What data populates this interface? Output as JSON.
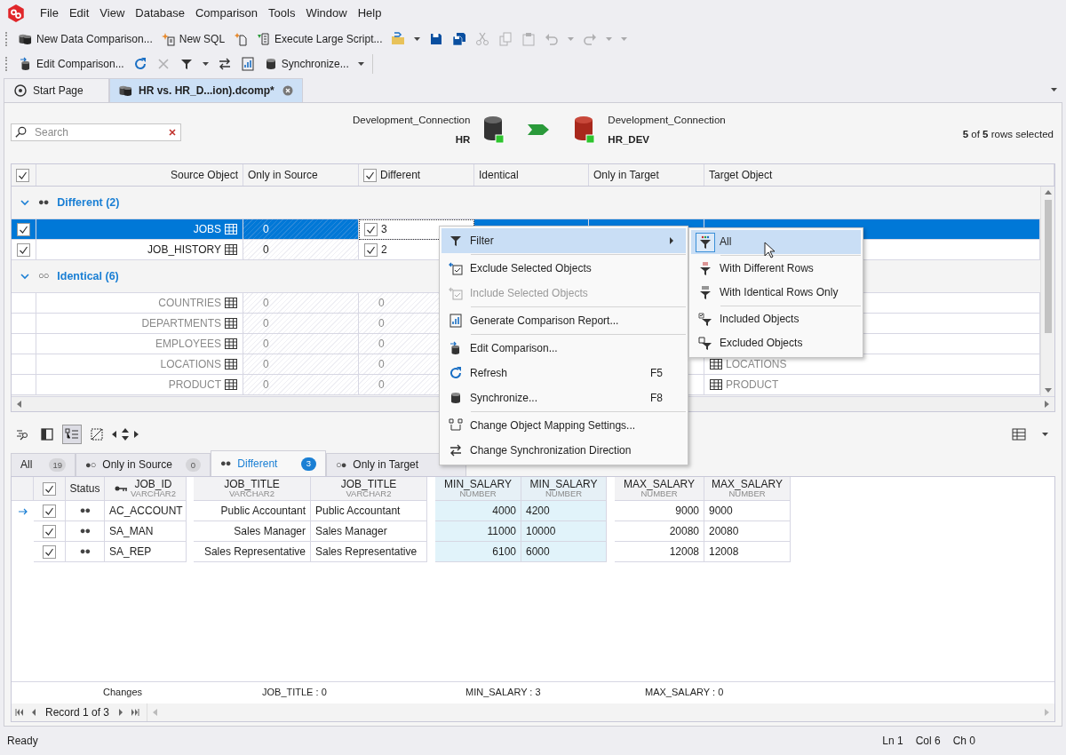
{
  "app_menu": [
    "File",
    "Edit",
    "View",
    "Database",
    "Comparison",
    "Tools",
    "Window",
    "Help"
  ],
  "toolbar_1": [
    {
      "label": "New Data Comparison...",
      "disabled": false,
      "dropdown": false
    },
    {
      "label": "New SQL",
      "disabled": false,
      "dropdown": false
    },
    {
      "disabled": false,
      "dropdown": false
    },
    {
      "label": "Execute Large Script...",
      "disabled": false,
      "dropdown": false
    },
    {
      "disabled": false,
      "dropdown": true
    },
    {
      "disabled": false,
      "dropdown": false
    },
    {
      "disabled": false,
      "dropdown": false
    },
    {
      "disabled": true,
      "dropdown": false
    },
    {
      "disabled": true,
      "dropdown": false
    },
    {
      "disabled": true,
      "dropdown": false
    },
    {
      "disabled": true,
      "dropdown": true
    },
    {
      "disabled": true,
      "dropdown": true
    }
  ],
  "toolbar_2": [
    {
      "label": "Edit Comparison...",
      "disabled": false,
      "dropdown": false
    },
    {
      "disabled": false,
      "dropdown": false
    },
    {
      "disabled": true,
      "dropdown": false
    },
    {
      "disabled": false,
      "dropdown": true
    },
    {
      "disabled": false,
      "dropdown": false
    },
    {
      "disabled": false,
      "dropdown": false
    },
    {
      "label": "Synchronize...",
      "disabled": false,
      "dropdown": true
    }
  ],
  "document_tabs": [
    {
      "label": "Start Page",
      "selected": false
    },
    {
      "label": "HR vs. HR_D...ion).dcomp*",
      "selected": true
    }
  ],
  "search": {
    "placeholder": "Search"
  },
  "source": {
    "connection": "Development_Connection",
    "database": "HR"
  },
  "target": {
    "connection": "Development_Connection",
    "database": "HR_DEV"
  },
  "selection_summary": "**5** of **5** rows selected",
  "object_grid": {
    "all_checked": true,
    "columns": [
      {
        "kind": "text",
        "label": "Source Object"
      },
      {
        "kind": "text",
        "label": "Only in Source"
      },
      {
        "kind": "check",
        "label": "Different",
        "checked": true
      },
      {
        "kind": "text",
        "label": "Identical"
      },
      {
        "kind": "text",
        "label": "Only in Target"
      },
      {
        "kind": "text",
        "label": "Target Object"
      }
    ],
    "groups": [
      {
        "label": "Different (2)",
        "dots": "●●",
        "expanded": true,
        "rows": [
          {
            "source": "JOBS",
            "only_in_source": "0",
            "different": "3",
            "included": true,
            "selected": true
          },
          {
            "source": "JOB_HISTORY",
            "only_in_source": "0",
            "different": "2",
            "included": true,
            "selected": false
          }
        ]
      },
      {
        "label": "Identical (6)",
        "dots": "○○",
        "expanded": true,
        "rows": [
          {
            "source": "COUNTRIES",
            "only_in_source": "0",
            "different": "0",
            "included": false,
            "selected": false
          },
          {
            "source": "DEPARTMENTS",
            "only_in_source": "0",
            "different": "0",
            "included": false,
            "selected": false
          },
          {
            "source": "EMPLOYEES",
            "only_in_source": "0",
            "different": "0",
            "included": false,
            "selected": false
          },
          {
            "source": "LOCATIONS",
            "only_in_source": "0",
            "different": "0",
            "target": "LOCATIONS",
            "included": false,
            "selected": false
          },
          {
            "source": "PRODUCT",
            "only_in_source": "0",
            "different": "0",
            "target": "PRODUCT",
            "included": false,
            "selected": false
          }
        ]
      }
    ]
  },
  "view_tools": [
    {
      "pressed": false
    },
    {
      "pressed": false
    },
    {
      "pressed": true
    },
    {
      "pressed": false
    }
  ],
  "data_tabs": [
    {
      "label": "All",
      "count": "19",
      "selected": false
    },
    {
      "dots": "●○",
      "label": "Only in Source",
      "count": "0",
      "selected": false
    },
    {
      "dots": "●●",
      "label": "Different",
      "count": "3",
      "selected": true
    },
    {
      "dots": "○●",
      "label": "Only in Target",
      "selected": false
    }
  ],
  "data_grid": {
    "all_checked": true,
    "status_label": "Status",
    "key_column": {
      "label": "JOB_ID",
      "type": "VARCHAR2"
    },
    "pairs": [
      {
        "source": {
          "label": "JOB_TITLE",
          "type": "VARCHAR2"
        },
        "target": {
          "label": "JOB_TITLE",
          "type": "VARCHAR2"
        },
        "differs": false
      },
      {
        "source": {
          "label": "MIN_SALARY",
          "type": "NUMBER"
        },
        "target": {
          "label": "MIN_SALARY",
          "type": "NUMBER"
        },
        "differs": true
      },
      {
        "source": {
          "label": "MAX_SALARY",
          "type": "NUMBER"
        },
        "target": {
          "label": "MAX_SALARY",
          "type": "NUMBER"
        },
        "differs": false
      }
    ],
    "rows": [
      {
        "current": true,
        "checked": true,
        "status": "●●",
        "key": "AC_ACCOUNT",
        "values": [
          [
            "Public Accountant",
            "Public Accountant"
          ],
          [
            "4000",
            "4200"
          ],
          [
            "9000",
            "9000"
          ]
        ]
      },
      {
        "current": false,
        "checked": true,
        "status": "●●",
        "key": "SA_MAN",
        "values": [
          [
            "Sales Manager",
            "Sales Manager"
          ],
          [
            "11000",
            "10000"
          ],
          [
            "20080",
            "20080"
          ]
        ]
      },
      {
        "current": false,
        "checked": true,
        "status": "●●",
        "key": "SA_REP",
        "values": [
          [
            "Sales Representative",
            "Sales Representative"
          ],
          [
            "6100",
            "6000"
          ],
          [
            "12008",
            "12008"
          ]
        ]
      }
    ]
  },
  "summary": {
    "label": "Changes",
    "items": [
      "JOB_TITLE : 0",
      "MIN_SALARY : 3",
      "MAX_SALARY : 0"
    ]
  },
  "navigator": {
    "record": "Record 1 of 3"
  },
  "context_menu": [
    {
      "kind": "item",
      "label": "Filter",
      "submenu": true,
      "selected": true,
      "disabled": false
    },
    {
      "kind": "separator"
    },
    {
      "kind": "item",
      "label": "Exclude Selected Objects",
      "submenu": false,
      "selected": false,
      "disabled": false
    },
    {
      "kind": "item",
      "label": "Include Selected Objects",
      "submenu": false,
      "selected": false,
      "disabled": true
    },
    {
      "kind": "separator"
    },
    {
      "kind": "item",
      "label": "Generate Comparison Report...",
      "submenu": false,
      "selected": false,
      "disabled": false
    },
    {
      "kind": "separator"
    },
    {
      "kind": "item",
      "label": "Edit Comparison...",
      "submenu": false,
      "selected": false,
      "disabled": false
    },
    {
      "kind": "item",
      "label": "Refresh",
      "shortcut": "F5",
      "submenu": false,
      "selected": false,
      "disabled": false
    },
    {
      "kind": "item",
      "label": "Synchronize...",
      "shortcut": "F8",
      "submenu": false,
      "selected": false,
      "disabled": false
    },
    {
      "kind": "separator"
    },
    {
      "kind": "item",
      "label": "Change Object Mapping Settings...",
      "submenu": false,
      "selected": false,
      "disabled": false
    },
    {
      "kind": "item",
      "label": "Change Synchronization Direction",
      "submenu": false,
      "selected": false,
      "disabled": false
    }
  ],
  "filter_submenu": [
    {
      "kind": "item",
      "label": "All",
      "selected": true
    },
    {
      "kind": "separator"
    },
    {
      "kind": "item",
      "label": "With Different Rows",
      "selected": false
    },
    {
      "kind": "item",
      "label": "With Identical Rows Only",
      "selected": false
    },
    {
      "kind": "separator"
    },
    {
      "kind": "item",
      "label": "Included Objects",
      "selected": false
    },
    {
      "kind": "item",
      "label": "Excluded Objects",
      "selected": false
    }
  ],
  "status_bar": {
    "message": "Ready",
    "position": [
      "Ln 1",
      "Col 6",
      "Ch 0"
    ]
  }
}
